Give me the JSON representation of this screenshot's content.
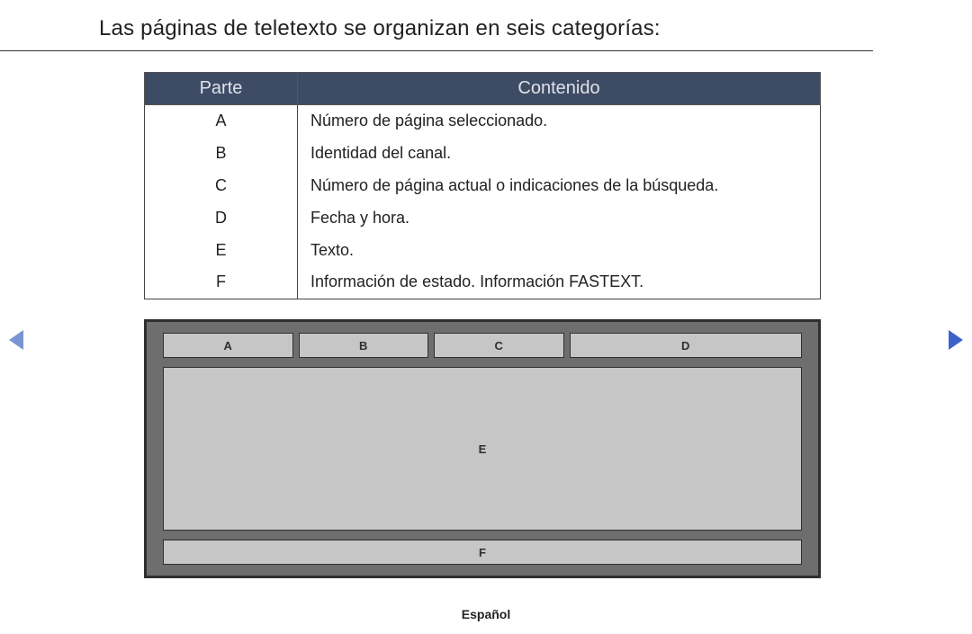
{
  "title": "Las páginas de teletexto se organizan en seis categorías:",
  "table": {
    "headers": {
      "part": "Parte",
      "content": "Contenido"
    },
    "rows": [
      {
        "part": "A",
        "content": "Número de página seleccionado."
      },
      {
        "part": "B",
        "content": "Identidad del canal."
      },
      {
        "part": "C",
        "content": "Número de página actual o indicaciones de la búsqueda."
      },
      {
        "part": "D",
        "content": "Fecha y hora."
      },
      {
        "part": "E",
        "content": "Texto."
      },
      {
        "part": "F",
        "content": "Información de estado. Información FASTEXT."
      }
    ]
  },
  "layout": {
    "a": "A",
    "b": "B",
    "c": "C",
    "d": "D",
    "e": "E",
    "f": "F"
  },
  "footer": {
    "language": "Español"
  }
}
